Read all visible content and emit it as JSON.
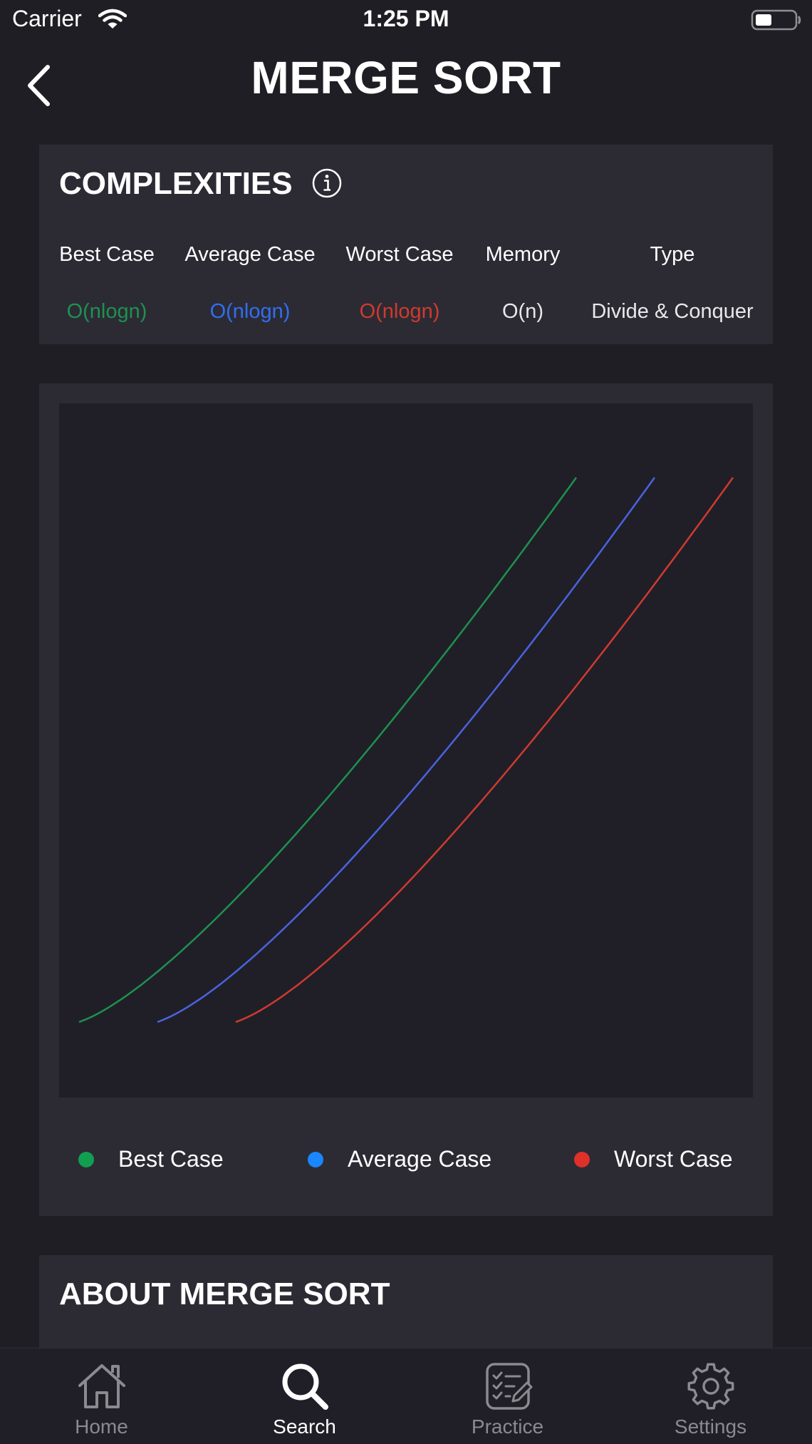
{
  "status_bar": {
    "carrier": "Carrier",
    "time": "1:25 PM"
  },
  "header": {
    "title": "MERGE SORT"
  },
  "complexities": {
    "title": "COMPLEXITIES",
    "columns": [
      {
        "header": "Best Case",
        "value": "O(nlogn)",
        "color": "#1e9150"
      },
      {
        "header": "Average Case",
        "value": "O(nlogn)",
        "color": "#2f6ff0"
      },
      {
        "header": "Worst Case",
        "value": "O(nlogn)",
        "color": "#d03a2e"
      },
      {
        "header": "Memory",
        "value": "O(n)",
        "color": "#e8e8ea"
      },
      {
        "header": "Type",
        "value": "Divide & Conquer",
        "color": "#e8e8ea"
      }
    ]
  },
  "chart_data": {
    "type": "line",
    "title": "",
    "xlabel": "",
    "ylabel": "",
    "grid": false,
    "legend": "bottom",
    "series": [
      {
        "name": "Best Case",
        "color": "#1e9150",
        "curve": "nlogn",
        "offset": 0
      },
      {
        "name": "Average Case",
        "color": "#4a63e0",
        "curve": "nlogn",
        "offset": 1
      },
      {
        "name": "Worst Case",
        "color": "#d03a2e",
        "curve": "nlogn",
        "offset": 2
      }
    ]
  },
  "legend": {
    "items": [
      {
        "label": "Best Case",
        "color": "#10a050"
      },
      {
        "label": "Average Case",
        "color": "#1a86ff"
      },
      {
        "label": "Worst Case",
        "color": "#e0302a"
      }
    ]
  },
  "about": {
    "title": "ABOUT MERGE SORT"
  },
  "tab_bar": {
    "tabs": [
      {
        "label": "Home",
        "icon": "home-icon",
        "active": false
      },
      {
        "label": "Search",
        "icon": "search-icon",
        "active": true
      },
      {
        "label": "Practice",
        "icon": "practice-icon",
        "active": false
      },
      {
        "label": "Settings",
        "icon": "gear-icon",
        "active": false
      }
    ],
    "active_color": "#ffffff",
    "inactive_color": "#8a8a8f"
  }
}
